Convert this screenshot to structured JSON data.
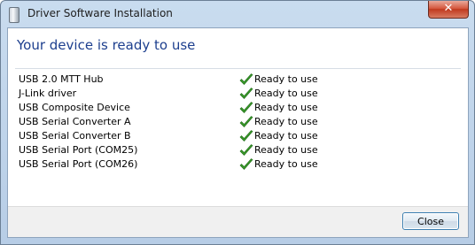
{
  "window": {
    "title": "Driver Software Installation",
    "heading": "Your device is ready to use"
  },
  "devices": [
    {
      "name": "USB 2.0 MTT Hub",
      "status": "Ready to use",
      "status_icon": "green-checkmark"
    },
    {
      "name": "J-Link driver",
      "status": "Ready to use",
      "status_icon": "green-checkmark"
    },
    {
      "name": "USB Composite Device",
      "status": "Ready to use",
      "status_icon": "green-checkmark"
    },
    {
      "name": "USB Serial Converter A",
      "status": "Ready to use",
      "status_icon": "green-checkmark"
    },
    {
      "name": "USB Serial Converter B",
      "status": "Ready to use",
      "status_icon": "green-checkmark"
    },
    {
      "name": "USB Serial Port (COM25)",
      "status": "Ready to use",
      "status_icon": "green-checkmark"
    },
    {
      "name": "USB Serial Port (COM26)",
      "status": "Ready to use",
      "status_icon": "green-checkmark"
    }
  ],
  "footer": {
    "close_label": "Close"
  },
  "colors": {
    "heading": "#1d3f8e",
    "check": "#3a9a2a"
  }
}
